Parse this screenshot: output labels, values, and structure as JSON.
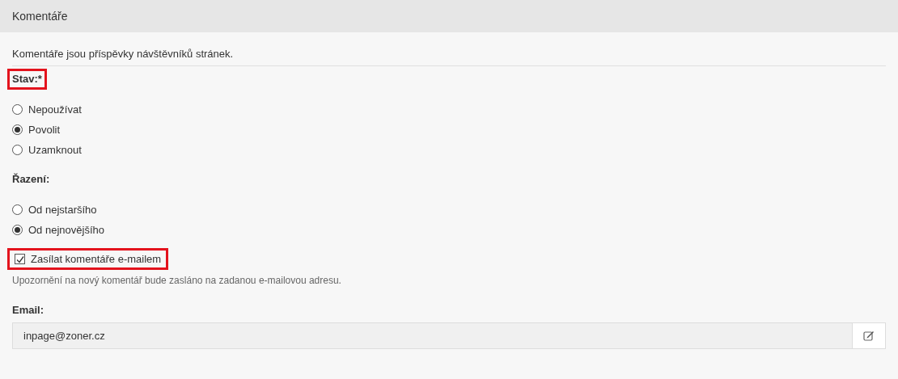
{
  "header": {
    "title": "Komentáře"
  },
  "description": "Komentáře jsou příspěvky návštěvníků stránek.",
  "groups": [
    {
      "label": "Stav:*",
      "highlighted": true,
      "options": [
        {
          "label": "Nepoužívat",
          "selected": false
        },
        {
          "label": "Povolit",
          "selected": true
        },
        {
          "label": "Uzamknout",
          "selected": false
        }
      ]
    },
    {
      "label": "Řazení:",
      "highlighted": false,
      "options": [
        {
          "label": "Od nejstaršího",
          "selected": false
        },
        {
          "label": "Od nejnovějšího",
          "selected": true
        }
      ]
    }
  ],
  "notify": {
    "label": "Zasílat komentáře e-mailem",
    "checked": true,
    "highlighted": true,
    "hint": "Upozornění na nový komentář bude zasláno na zadanou e-mailovou adresu."
  },
  "email": {
    "label": "Email:",
    "value": "inpage@zoner.cz"
  }
}
